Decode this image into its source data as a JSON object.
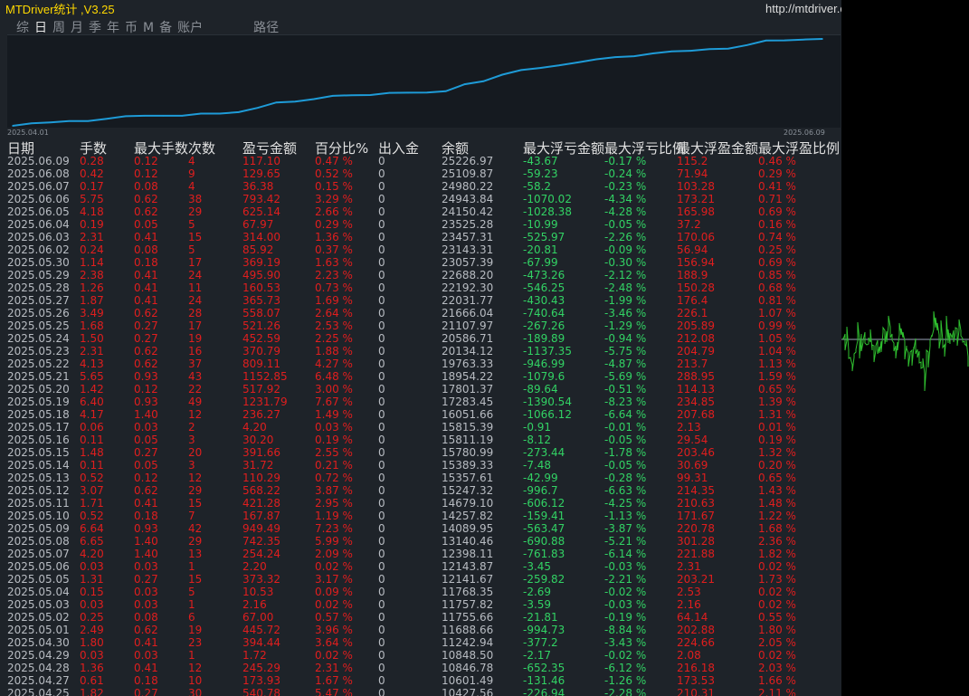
{
  "window": {
    "title": "MTDriver统计 ,V3.25",
    "url": "http://mtdriver.cn"
  },
  "tabs": [
    {
      "label": "综",
      "active": false
    },
    {
      "label": "日",
      "active": true
    },
    {
      "label": "周",
      "active": false
    },
    {
      "label": "月",
      "active": false
    },
    {
      "label": "季",
      "active": false
    },
    {
      "label": "年",
      "active": false
    },
    {
      "label": "币",
      "active": false
    },
    {
      "label": "M",
      "active": false
    },
    {
      "label": "备",
      "active": false
    },
    {
      "label": "账户",
      "active": false
    },
    {
      "label": "路径",
      "active": false
    }
  ],
  "chart_data": {
    "type": "line",
    "xlabel_start": "2025.04.01",
    "xlabel_end": "2025.06.09",
    "line_color": "#1e9bd7",
    "x": [
      "2025.04.01",
      "2025.04.25",
      "2025.04.27",
      "2025.04.28",
      "2025.04.29",
      "2025.04.30",
      "2025.05.01",
      "2025.05.02",
      "2025.05.03",
      "2025.05.04",
      "2025.05.05",
      "2025.05.06",
      "2025.05.07",
      "2025.05.08",
      "2025.05.09",
      "2025.05.10",
      "2025.05.11",
      "2025.05.12",
      "2025.05.13",
      "2025.05.14",
      "2025.05.15",
      "2025.05.16",
      "2025.05.17",
      "2025.05.18",
      "2025.05.19",
      "2025.05.20",
      "2025.05.21",
      "2025.05.22",
      "2025.05.23",
      "2025.05.24",
      "2025.05.25",
      "2025.05.26",
      "2025.05.27",
      "2025.05.28",
      "2025.05.29",
      "2025.05.30",
      "2025.06.02",
      "2025.06.03",
      "2025.06.04",
      "2025.06.05",
      "2025.06.06",
      "2025.06.07",
      "2025.06.08",
      "2025.06.09"
    ],
    "y": [
      10000,
      10427.56,
      10601.49,
      10846.78,
      10848.5,
      11242.94,
      11688.66,
      11755.66,
      11757.82,
      11768.35,
      12141.67,
      12143.87,
      12398.11,
      13140.46,
      14089.95,
      14257.82,
      14679.1,
      15247.32,
      15357.61,
      15389.33,
      15780.99,
      15811.19,
      15815.39,
      16051.66,
      17283.45,
      17801.37,
      18954.22,
      19763.33,
      20134.12,
      20586.71,
      21107.97,
      21666.04,
      22031.77,
      22192.3,
      22688.2,
      23057.39,
      23143.31,
      23457.31,
      23525.28,
      24150.42,
      24943.84,
      24980.22,
      25109.87,
      25226.97
    ]
  },
  "table": {
    "headers": [
      "日期",
      "手数",
      "最大手数",
      "次数",
      "盈亏金额",
      "百分比%",
      "出入金",
      "余额",
      "最大浮亏金额",
      "最大浮亏比例",
      "最大浮盈金额",
      "最大浮盈比例"
    ],
    "rows": [
      [
        "2025.06.09",
        "0.28",
        "0.12",
        "4",
        "117.10",
        "0.47 %",
        "0",
        "25226.97",
        "-43.67",
        "-0.17 %",
        "115.2",
        "0.46 %"
      ],
      [
        "2025.06.08",
        "0.42",
        "0.12",
        "9",
        "129.65",
        "0.52 %",
        "0",
        "25109.87",
        "-59.23",
        "-0.24 %",
        "71.94",
        "0.29 %"
      ],
      [
        "2025.06.07",
        "0.17",
        "0.08",
        "4",
        "36.38",
        "0.15 %",
        "0",
        "24980.22",
        "-58.2",
        "-0.23 %",
        "103.28",
        "0.41 %"
      ],
      [
        "2025.06.06",
        "5.75",
        "0.62",
        "38",
        "793.42",
        "3.29 %",
        "0",
        "24943.84",
        "-1070.02",
        "-4.34 %",
        "173.21",
        "0.71 %"
      ],
      [
        "2025.06.05",
        "4.18",
        "0.62",
        "29",
        "625.14",
        "2.66 %",
        "0",
        "24150.42",
        "-1028.38",
        "-4.28 %",
        "165.98",
        "0.69 %"
      ],
      [
        "2025.06.04",
        "0.19",
        "0.05",
        "5",
        "67.97",
        "0.29 %",
        "0",
        "23525.28",
        "-10.99",
        "-0.05 %",
        "37.2",
        "0.16 %"
      ],
      [
        "2025.06.03",
        "2.31",
        "0.41",
        "15",
        "314.00",
        "1.36 %",
        "0",
        "23457.31",
        "-525.97",
        "-2.26 %",
        "170.06",
        "0.74 %"
      ],
      [
        "2025.06.02",
        "0.24",
        "0.08",
        "5",
        "85.92",
        "0.37 %",
        "0",
        "23143.31",
        "-20.81",
        "-0.09 %",
        "56.94",
        "0.25 %"
      ],
      [
        "2025.05.30",
        "1.14",
        "0.18",
        "17",
        "369.19",
        "1.63 %",
        "0",
        "23057.39",
        "-67.99",
        "-0.30 %",
        "156.94",
        "0.69 %"
      ],
      [
        "2025.05.29",
        "2.38",
        "0.41",
        "24",
        "495.90",
        "2.23 %",
        "0",
        "22688.20",
        "-473.26",
        "-2.12 %",
        "188.9",
        "0.85 %"
      ],
      [
        "2025.05.28",
        "1.26",
        "0.41",
        "11",
        "160.53",
        "0.73 %",
        "0",
        "22192.30",
        "-546.25",
        "-2.48 %",
        "150.28",
        "0.68 %"
      ],
      [
        "2025.05.27",
        "1.87",
        "0.41",
        "24",
        "365.73",
        "1.69 %",
        "0",
        "22031.77",
        "-430.43",
        "-1.99 %",
        "176.4",
        "0.81 %"
      ],
      [
        "2025.05.26",
        "3.49",
        "0.62",
        "28",
        "558.07",
        "2.64 %",
        "0",
        "21666.04",
        "-740.64",
        "-3.46 %",
        "226.1",
        "1.07 %"
      ],
      [
        "2025.05.25",
        "1.68",
        "0.27",
        "17",
        "521.26",
        "2.53 %",
        "0",
        "21107.97",
        "-267.26",
        "-1.29 %",
        "205.89",
        "0.99 %"
      ],
      [
        "2025.05.24",
        "1.50",
        "0.27",
        "19",
        "452.59",
        "2.25 %",
        "0",
        "20586.71",
        "-189.89",
        "-0.94 %",
        "212.08",
        "1.05 %"
      ],
      [
        "2025.05.23",
        "2.31",
        "0.62",
        "16",
        "370.79",
        "1.88 %",
        "0",
        "20134.12",
        "-1137.35",
        "-5.75 %",
        "204.79",
        "1.04 %"
      ],
      [
        "2025.05.22",
        "4.13",
        "0.62",
        "37",
        "809.11",
        "4.27 %",
        "0",
        "19763.33",
        "-946.99",
        "-4.87 %",
        "213.7",
        "1.13 %"
      ],
      [
        "2025.05.21",
        "5.65",
        "0.93",
        "43",
        "1152.85",
        "6.48 %",
        "0",
        "18954.22",
        "-1079.6",
        "-5.69 %",
        "288.95",
        "1.59 %"
      ],
      [
        "2025.05.20",
        "1.42",
        "0.12",
        "22",
        "517.92",
        "3.00 %",
        "0",
        "17801.37",
        "-89.64",
        "-0.51 %",
        "114.13",
        "0.65 %"
      ],
      [
        "2025.05.19",
        "6.40",
        "0.93",
        "49",
        "1231.79",
        "7.67 %",
        "0",
        "17283.45",
        "-1390.54",
        "-8.23 %",
        "234.85",
        "1.39 %"
      ],
      [
        "2025.05.18",
        "4.17",
        "1.40",
        "12",
        "236.27",
        "1.49 %",
        "0",
        "16051.66",
        "-1066.12",
        "-6.64 %",
        "207.68",
        "1.31 %"
      ],
      [
        "2025.05.17",
        "0.06",
        "0.03",
        "2",
        "4.20",
        "0.03 %",
        "0",
        "15815.39",
        "-0.91",
        "-0.01 %",
        "2.13",
        "0.01 %"
      ],
      [
        "2025.05.16",
        "0.11",
        "0.05",
        "3",
        "30.20",
        "0.19 %",
        "0",
        "15811.19",
        "-8.12",
        "-0.05 %",
        "29.54",
        "0.19 %"
      ],
      [
        "2025.05.15",
        "1.48",
        "0.27",
        "20",
        "391.66",
        "2.55 %",
        "0",
        "15780.99",
        "-273.44",
        "-1.78 %",
        "203.46",
        "1.32 %"
      ],
      [
        "2025.05.14",
        "0.11",
        "0.05",
        "3",
        "31.72",
        "0.21 %",
        "0",
        "15389.33",
        "-7.48",
        "-0.05 %",
        "30.69",
        "0.20 %"
      ],
      [
        "2025.05.13",
        "0.52",
        "0.12",
        "12",
        "110.29",
        "0.72 %",
        "0",
        "15357.61",
        "-42.99",
        "-0.28 %",
        "99.31",
        "0.65 %"
      ],
      [
        "2025.05.12",
        "3.07",
        "0.62",
        "29",
        "568.22",
        "3.87 %",
        "0",
        "15247.32",
        "-996.7",
        "-6.63 %",
        "214.35",
        "1.43 %"
      ],
      [
        "2025.05.11",
        "1.71",
        "0.41",
        "15",
        "421.28",
        "2.95 %",
        "0",
        "14679.10",
        "-606.12",
        "-4.25 %",
        "210.63",
        "1.48 %"
      ],
      [
        "2025.05.10",
        "0.52",
        "0.18",
        "7",
        "167.87",
        "1.19 %",
        "0",
        "14257.82",
        "-159.41",
        "-1.13 %",
        "171.67",
        "1.22 %"
      ],
      [
        "2025.05.09",
        "6.64",
        "0.93",
        "42",
        "949.49",
        "7.23 %",
        "0",
        "14089.95",
        "-563.47",
        "-3.87 %",
        "220.78",
        "1.68 %"
      ],
      [
        "2025.05.08",
        "6.65",
        "1.40",
        "29",
        "742.35",
        "5.99 %",
        "0",
        "13140.46",
        "-690.88",
        "-5.21 %",
        "301.28",
        "2.36 %"
      ],
      [
        "2025.05.07",
        "4.20",
        "1.40",
        "13",
        "254.24",
        "2.09 %",
        "0",
        "12398.11",
        "-761.83",
        "-6.14 %",
        "221.88",
        "1.82 %"
      ],
      [
        "2025.05.06",
        "0.03",
        "0.03",
        "1",
        "2.20",
        "0.02 %",
        "0",
        "12143.87",
        "-3.45",
        "-0.03 %",
        "2.31",
        "0.02 %"
      ],
      [
        "2025.05.05",
        "1.31",
        "0.27",
        "15",
        "373.32",
        "3.17 %",
        "0",
        "12141.67",
        "-259.82",
        "-2.21 %",
        "203.21",
        "1.73 %"
      ],
      [
        "2025.05.04",
        "0.15",
        "0.03",
        "5",
        "10.53",
        "0.09 %",
        "0",
        "11768.35",
        "-2.69",
        "-0.02 %",
        "2.53",
        "0.02 %"
      ],
      [
        "2025.05.03",
        "0.03",
        "0.03",
        "1",
        "2.16",
        "0.02 %",
        "0",
        "11757.82",
        "-3.59",
        "-0.03 %",
        "2.16",
        "0.02 %"
      ],
      [
        "2025.05.02",
        "0.25",
        "0.08",
        "6",
        "67.00",
        "0.57 %",
        "0",
        "11755.66",
        "-21.81",
        "-0.19 %",
        "64.14",
        "0.55 %"
      ],
      [
        "2025.05.01",
        "2.49",
        "0.62",
        "19",
        "445.72",
        "3.96 %",
        "0",
        "11688.66",
        "-994.73",
        "-8.84 %",
        "202.88",
        "1.80 %"
      ],
      [
        "2025.04.30",
        "1.80",
        "0.41",
        "23",
        "394.44",
        "3.64 %",
        "0",
        "11242.94",
        "-377.2",
        "-3.43 %",
        "224.66",
        "2.05 %"
      ],
      [
        "2025.04.29",
        "0.03",
        "0.03",
        "1",
        "1.72",
        "0.02 %",
        "0",
        "10848.50",
        "-2.17",
        "-0.02 %",
        "2.08",
        "0.02 %"
      ],
      [
        "2025.04.28",
        "1.36",
        "0.41",
        "12",
        "245.29",
        "2.31 %",
        "0",
        "10846.78",
        "-652.35",
        "-6.12 %",
        "216.18",
        "2.03 %"
      ],
      [
        "2025.04.27",
        "0.61",
        "0.18",
        "10",
        "173.93",
        "1.67 %",
        "0",
        "10601.49",
        "-131.46",
        "-1.26 %",
        "173.53",
        "1.66 %"
      ],
      [
        "2025.04.25",
        "1.82",
        "0.27",
        "30",
        "540.78",
        "5.47 %",
        "0",
        "10427.56",
        "-226.94",
        "-2.28 %",
        "210.31",
        "2.11 %"
      ]
    ]
  },
  "colors": {
    "title": "#ffd800",
    "negative": "#e01e1e",
    "positive": "#32d264",
    "line": "#1e9bd7",
    "background": "#1e2329"
  }
}
